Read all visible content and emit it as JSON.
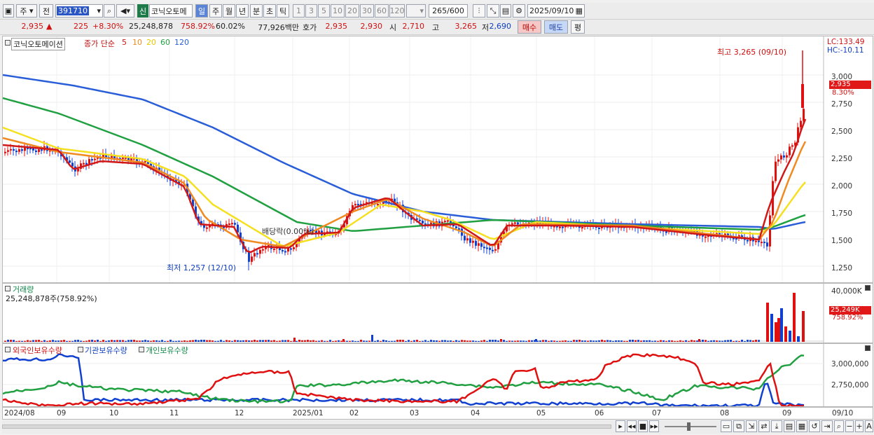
{
  "toolbar": {
    "market": "주",
    "prev": "전",
    "code": "391710",
    "name": "코닉오토메",
    "new_badge": "신",
    "periods": [
      "일",
      "주",
      "월",
      "년",
      "분",
      "초",
      "틱"
    ],
    "intervals": [
      "1",
      "3",
      "5",
      "10",
      "20",
      "30",
      "60",
      "120"
    ],
    "count": "265",
    "total": "/600",
    "date": "2025/09/10"
  },
  "quote": {
    "price": "2,935",
    "arrow": "▲",
    "change": "225",
    "rate": "+8.30%",
    "volume": "25,248,878",
    "vol_ratio": "758.92%",
    "turnover": "60.02%",
    "amount": "77,926백만",
    "ask_label": "호가",
    "ask1": "2,935",
    "ask2": "2,930",
    "open_label": "시",
    "open": "2,710",
    "high_label": "고",
    "high": "3,265",
    "low_label": "저",
    "low": "2,690",
    "buy": "매수",
    "sell": "매도",
    "avg": "평"
  },
  "price_panel": {
    "name": "코닉오토메이션",
    "ma_label": "종가 단순",
    "ma": [
      "5",
      "10",
      "20",
      "60",
      "120"
    ],
    "lc": "LC:133.49",
    "hc": "HC:-10.11",
    "max_note": "최고 3,265 (09/10)",
    "min_note": "최저 1,257 (12/10)",
    "dividend_note": "배당락(0.00%)",
    "y_ticks": [
      "3,000",
      "2,750",
      "2,500",
      "2,250",
      "2,000",
      "1,750",
      "1,500",
      "1,250"
    ],
    "cur_tag": "2,935",
    "cur_pct": "8.30%"
  },
  "volume_panel": {
    "title": "거래량",
    "value": "25,248,878주(758.92%)",
    "y_tick": "40,000K",
    "cur_tag": "25,249K",
    "cur_pct": "758.92%"
  },
  "holding_panel": {
    "s1": "외국인보유수량",
    "s2": "기관보유수량",
    "s3": "개인보유수량",
    "y_ticks": [
      "3,000,000",
      "2,750,000"
    ]
  },
  "x_axis": [
    "2024/08",
    "09",
    "10",
    "11",
    "12",
    "2025/01",
    "02",
    "03",
    "04",
    "05",
    "06",
    "07",
    "08",
    "09"
  ],
  "x_last": "09/10",
  "colors": {
    "up": "#e01010",
    "down": "#1040d0",
    "ma5": "#d01818",
    "ma10": "#f08a20",
    "ma20": "#f5e020",
    "ma60": "#20a040",
    "ma120": "#2a5ed8"
  }
}
